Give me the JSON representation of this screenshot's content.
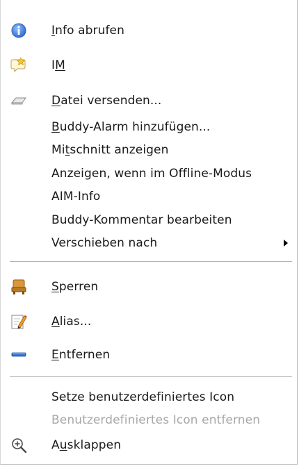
{
  "menu": {
    "items": [
      {
        "mn": "I",
        "rest": "nfo abrufen",
        "icon": "info-icon"
      },
      {
        "pre": "I",
        "mn": "M",
        "rest": "",
        "icon": "im-icon"
      },
      {
        "mn": "D",
        "rest": "atei versenden...",
        "icon": "send-file-icon"
      },
      {
        "mn": "B",
        "rest": "uddy-Alarm hinzufügen..."
      },
      {
        "pre": "Mi",
        "mn": "t",
        "rest": "schnitt anzeigen"
      },
      {
        "label": "Anzeigen, wenn im Offline-Modus"
      },
      {
        "label": "AIM-Info"
      },
      {
        "label": "Buddy-Kommentar bearbeiten"
      },
      {
        "label": "Verschieben nach",
        "submenu": true
      },
      {
        "mn": "S",
        "rest": "perren",
        "icon": "block-icon"
      },
      {
        "mn": "A",
        "rest": "lias...",
        "icon": "alias-edit-icon"
      },
      {
        "mn": "E",
        "rest": "ntfernen",
        "icon": "remove-icon"
      },
      {
        "label": "Setze benutzerdefiniertes Icon"
      },
      {
        "label": "Benutzerdefiniertes Icon entfernen",
        "disabled": true
      },
      {
        "pre": "A",
        "mn": "u",
        "rest": "sklappen",
        "icon": "zoom-in-icon"
      }
    ]
  },
  "colors": {
    "text": "#1a1a1a",
    "disabled_text": "#a8a8a8",
    "info_icon": "#3a78d8",
    "remove_icon": "#2f6fd0",
    "block_icon": "#c8882a"
  }
}
